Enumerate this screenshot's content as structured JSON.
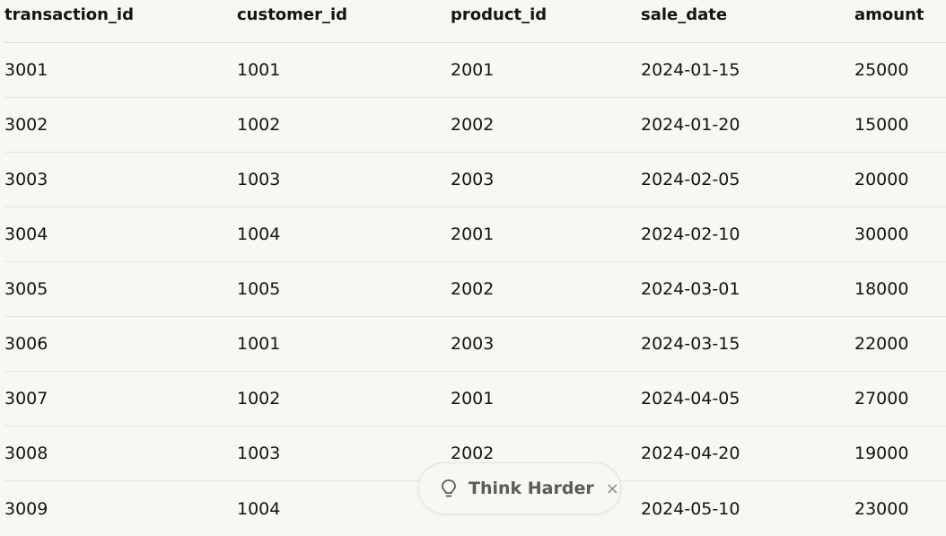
{
  "table": {
    "columns": [
      "transaction_id",
      "customer_id",
      "product_id",
      "sale_date",
      "amount"
    ],
    "rows": [
      [
        "3001",
        "1001",
        "2001",
        "2024-01-15",
        "25000"
      ],
      [
        "3002",
        "1002",
        "2002",
        "2024-01-20",
        "15000"
      ],
      [
        "3003",
        "1003",
        "2003",
        "2024-02-05",
        "20000"
      ],
      [
        "3004",
        "1004",
        "2001",
        "2024-02-10",
        "30000"
      ],
      [
        "3005",
        "1005",
        "2002",
        "2024-03-01",
        "18000"
      ],
      [
        "3006",
        "1001",
        "2003",
        "2024-03-15",
        "22000"
      ],
      [
        "3007",
        "1002",
        "2001",
        "2024-04-05",
        "27000"
      ],
      [
        "3008",
        "1003",
        "2002",
        "2024-04-20",
        "19000"
      ],
      [
        "3009",
        "1004",
        "",
        "2024-05-10",
        "23000"
      ]
    ]
  },
  "think_harder": {
    "label": "Think Harder",
    "close_glyph": "×",
    "icon": "lightbulb-icon"
  }
}
